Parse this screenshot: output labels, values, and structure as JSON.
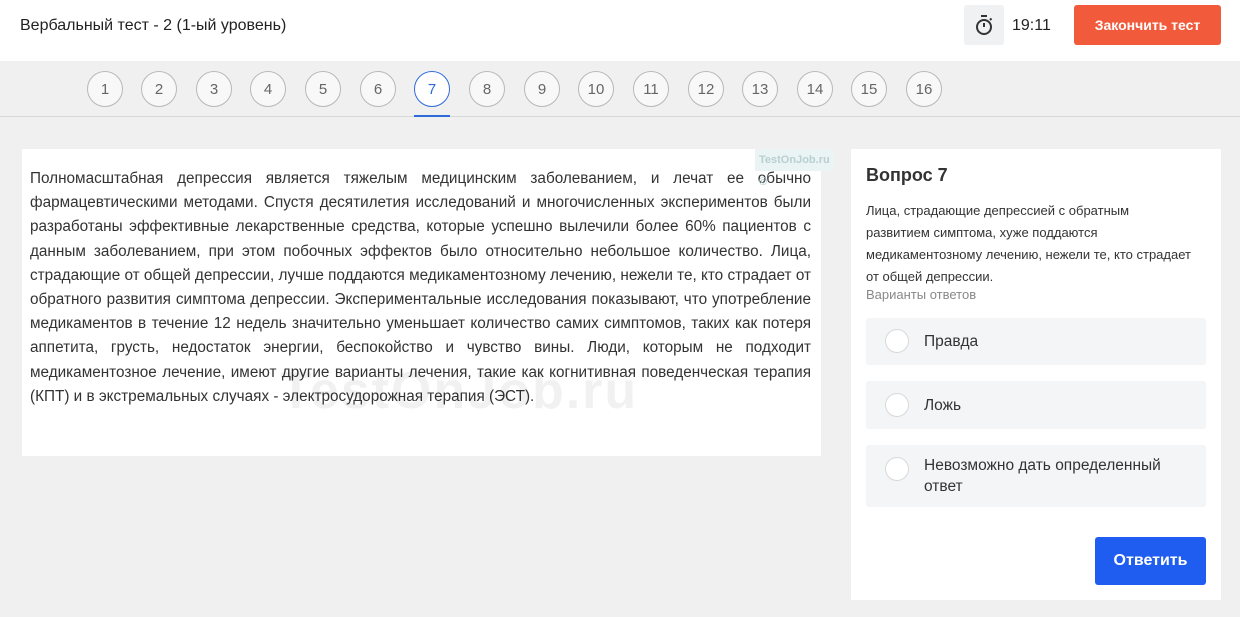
{
  "header": {
    "title": "Вербальный тест - 2 (1-ый уровень)",
    "timer": "19:11",
    "finish_label": "Закончить тест"
  },
  "nav": {
    "numbers": [
      "1",
      "2",
      "3",
      "4",
      "5",
      "6",
      "7",
      "8",
      "9",
      "10",
      "11",
      "12",
      "13",
      "14",
      "15",
      "16"
    ],
    "active": "7"
  },
  "passage": {
    "text": "Полномасштабная депрессия является тяжелым медицинским заболеванием, и лечат ее обычно фармацевтическими методами. Спустя десятилетия исследований и многочисленных экспериментов были разработаны эффективные лекарственные средства, которые успешно вылечили более 60% пациентов с данным заболеванием, при этом побочных эффектов было относительно небольшое количество. Лица, страдающие от общей депрессии, лучше поддаются медикаментозному лечению, нежели те, кто страдает от обратного развития симптома депрессии. Экспериментальные исследования показывают, что употребление медикаментов в течение 12 недель значительно уменьшает количество самих симптомов, таких как потеря аппетита, грусть, недостаток энергии, беспокойство и чувство вины. Люди, которым не подходит медикаментозное лечение, имеют другие варианты лечения, такие как когнитивная поведенческая терапия (КПТ) и в экстремальных случаях - электросудорожная терапия (ЭСТ).",
    "watermark_small": "TestOnJob.ru ©",
    "watermark_big": "TestOnJob.ru"
  },
  "question": {
    "title": "Вопрос 7",
    "text": "Лица, страдающие депрессией с обратным развитием симптома, хуже поддаются медикаментозному лечению, нежели те, кто страдает от общей депрессии.",
    "options_label": "Варианты ответов",
    "options": [
      {
        "label": "Правда"
      },
      {
        "label": "Ложь"
      },
      {
        "label": "Невозможно дать определенный ответ"
      }
    ],
    "submit_label": "Ответить"
  },
  "colors": {
    "accent": "#1f5df0",
    "finish": "#f15a3a",
    "active_nav": "#2f6ad9"
  },
  "icons": {
    "timer": "stopwatch-icon"
  }
}
